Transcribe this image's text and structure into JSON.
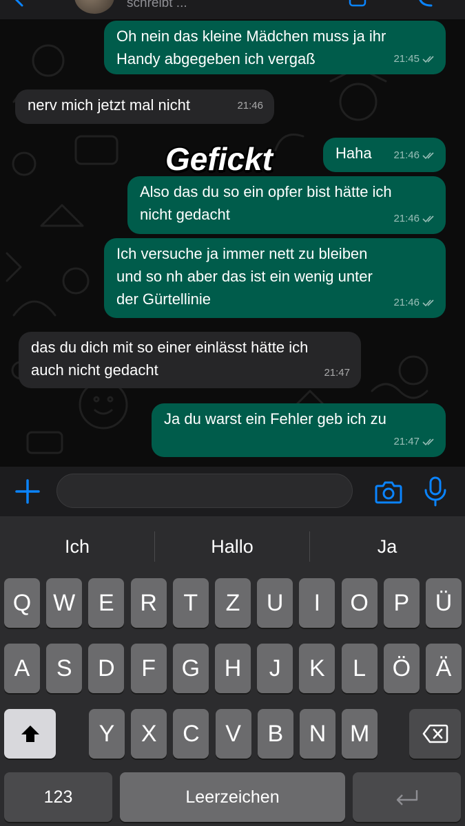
{
  "header": {
    "status_text": "schreibt ..."
  },
  "messages": [
    {
      "direction": "out",
      "text": "Oh nein das kleine Mädchen muss ja ihr\nHandy abgegeben ich vergaß",
      "time": "21:45",
      "read": true
    },
    {
      "direction": "in",
      "text": "nerv mich jetzt mal nicht",
      "time": "21:46"
    },
    {
      "direction": "out",
      "text": "Haha",
      "time": "21:46",
      "read": true
    },
    {
      "direction": "out",
      "text": "Also das du so ein opfer bist hätte ich\nnicht gedacht",
      "time": "21:46",
      "read": true
    },
    {
      "direction": "out",
      "text": "Ich versuche ja immer nett zu bleiben\nund so nh aber das ist ein wenig unter\nder Gürtellinie",
      "time": "21:46",
      "read": true
    },
    {
      "direction": "in",
      "text": "das du dich mit so einer einlässt hätte ich\nauch nicht gedacht",
      "time": "21:47"
    },
    {
      "direction": "out",
      "text": "Ja du warst ein Fehler geb ich zu",
      "time": "21:47",
      "read": true
    }
  ],
  "overlay_text": "Gefickt",
  "input": {
    "value": "",
    "placeholder": ""
  },
  "keyboard": {
    "suggestions": [
      "Ich",
      "Hallo",
      "Ja"
    ],
    "row1": [
      "Q",
      "W",
      "E",
      "R",
      "T",
      "Z",
      "U",
      "I",
      "O",
      "P",
      "Ü"
    ],
    "row2": [
      "A",
      "S",
      "D",
      "F",
      "G",
      "H",
      "J",
      "K",
      "L",
      "Ö",
      "Ä"
    ],
    "row3": [
      "Y",
      "X",
      "C",
      "V",
      "B",
      "N",
      "M"
    ],
    "numbers_label": "123",
    "space_label": "Leerzeichen"
  },
  "colors": {
    "outgoing_bubble": "#005c4b",
    "incoming_bubble": "#262628",
    "accent": "#0a84ff"
  },
  "icons": [
    "back-chevron-icon",
    "video-icon",
    "phone-icon",
    "plus-icon",
    "sticker-icon",
    "camera-icon",
    "microphone-icon",
    "shift-icon",
    "delete-icon",
    "return-icon",
    "double-check-icon"
  ]
}
